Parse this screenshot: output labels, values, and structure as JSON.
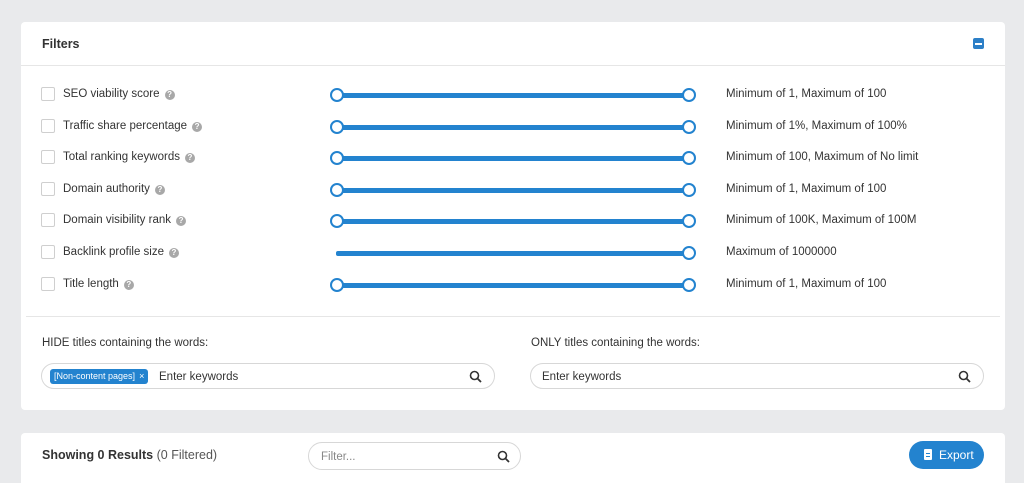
{
  "filters": {
    "title": "Filters",
    "rows": [
      {
        "label": "SEO viability score",
        "range": "Minimum of 1, Maximum of 100",
        "has_min_handle": true,
        "checked": false
      },
      {
        "label": "Traffic share percentage",
        "range": "Minimum of 1%, Maximum of 100%",
        "has_min_handle": true,
        "checked": false
      },
      {
        "label": "Total ranking keywords",
        "range": "Minimum of 100, Maximum of No limit",
        "has_min_handle": true,
        "checked": false
      },
      {
        "label": "Domain authority",
        "range": "Minimum of 1, Maximum of 100",
        "has_min_handle": true,
        "checked": false
      },
      {
        "label": "Domain visibility rank",
        "range": "Minimum of 100K, Maximum of 100M",
        "has_min_handle": true,
        "checked": false
      },
      {
        "label": "Backlink profile size",
        "range": "Maximum of 1000000",
        "has_min_handle": false,
        "checked": false
      },
      {
        "label": "Title length",
        "range": "Minimum of 1, Maximum of 100",
        "has_min_handle": true,
        "checked": false
      }
    ],
    "help_glyph": "?",
    "hide": {
      "label": "HIDE titles containing the words:",
      "tag": "[Non-content pages]",
      "tag_remove": "×",
      "placeholder": "Enter keywords"
    },
    "only": {
      "label": "ONLY titles containing the words:",
      "placeholder": "Enter keywords"
    }
  },
  "results": {
    "showing": "Showing 0 Results",
    "filtered": "(0 Filtered)",
    "filter_placeholder": "Filter...",
    "export_label": "Export"
  },
  "colors": {
    "accent": "#2383cf",
    "background": "#e9eaec"
  },
  "icons": {
    "collapse": "minus-square-icon",
    "help": "question-circle-icon",
    "search": "search-icon",
    "export": "document-icon"
  }
}
